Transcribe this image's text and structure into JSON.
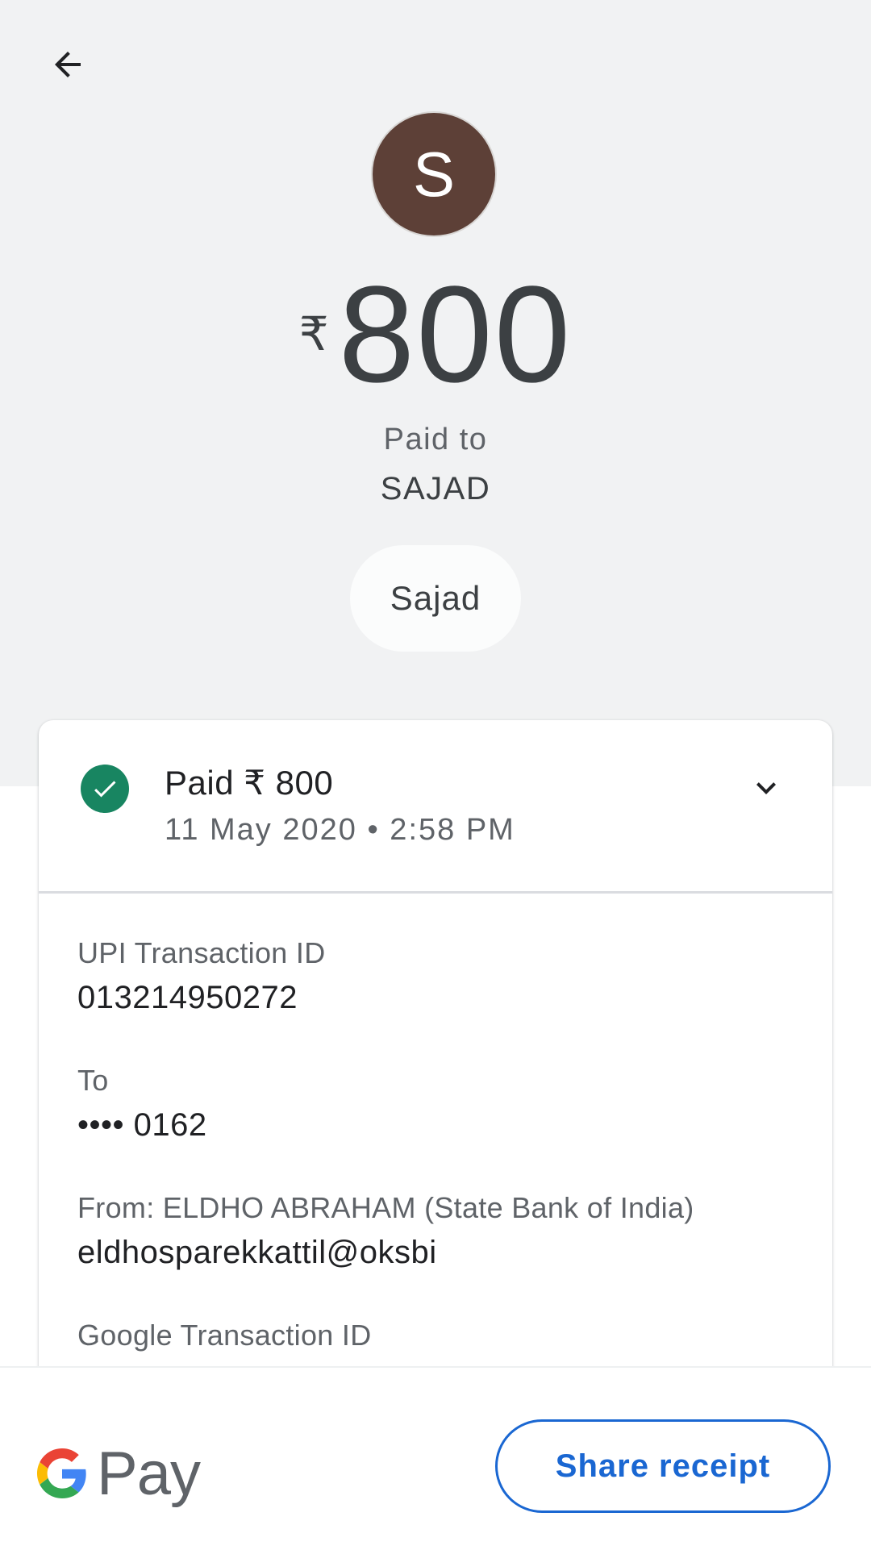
{
  "header": {
    "back_icon": "arrow-left-icon"
  },
  "payee": {
    "avatar_initial": "S",
    "avatar_color": "#5d4037",
    "currency_symbol": "₹",
    "amount": "800",
    "paid_to_label": "Paid to",
    "name": "SAJAD",
    "chip_label": "Sajad"
  },
  "card": {
    "status_icon": "check-circle-icon",
    "status_color": "#188561",
    "status_title": "Paid ₹ 800",
    "status_datetime": "11 May 2020 • 2:58 PM",
    "expand_icon": "chevron-down-icon",
    "details": [
      {
        "label": "UPI Transaction ID",
        "value": "013214950272"
      },
      {
        "label": "To",
        "value": "•••• 0162"
      },
      {
        "label": "From: ELDHO  ABRAHAM (State Bank of India)",
        "value": "eldhosparekkattil@oksbi"
      },
      {
        "label": "Google Transaction ID",
        "value": ""
      }
    ]
  },
  "footer": {
    "logo_text": "Pay",
    "share_label": "Share receipt",
    "accent_color": "#1a67d2"
  }
}
